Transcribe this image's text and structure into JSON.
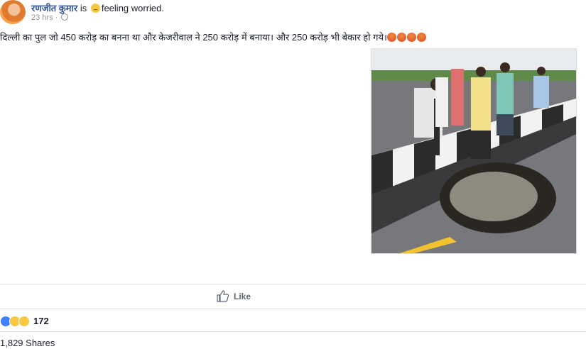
{
  "post": {
    "author_name": "रणजीत कुमार",
    "is_word": "is",
    "feeling_text": "feeling worried.",
    "timestamp": "23 hrs",
    "separator": "·",
    "text": "दिल्ली का पुल जो 450 करोड़ का बनना था और केजरीवाल ने 250 करोड़ में बनाया। और 250 करोड़ भी बेकार हो गये।",
    "trailing_emoji_count": 4
  },
  "actions": {
    "like_label": "Like"
  },
  "reactions": {
    "types": [
      "like",
      "haha",
      "sad"
    ],
    "count": "172"
  },
  "shares": {
    "label": "1,829 Shares"
  },
  "colors": {
    "link": "#365899",
    "meta": "#90949c",
    "divider": "#dddfe2",
    "angry": "#d94b2b"
  }
}
